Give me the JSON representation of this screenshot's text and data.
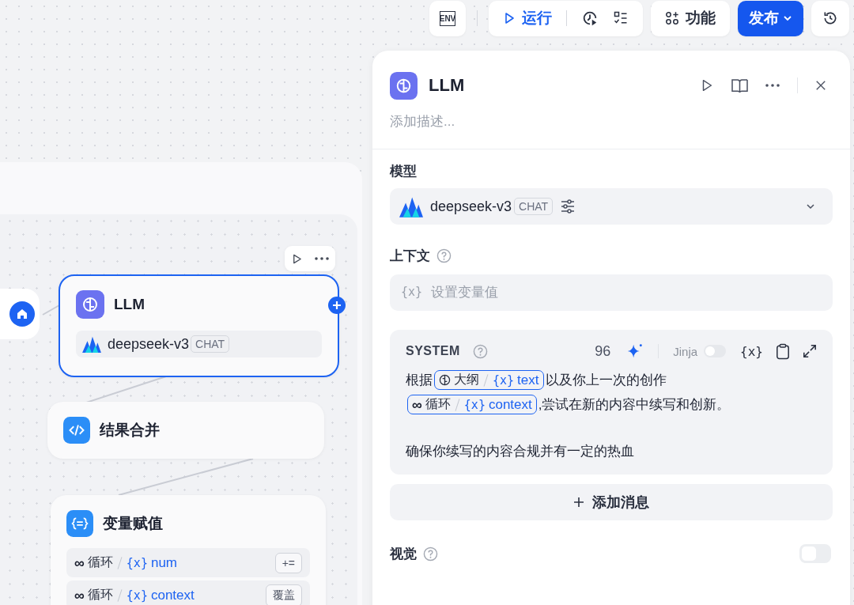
{
  "toolbar": {
    "env_label": "ENV",
    "run_label": "运行",
    "features_label": "功能",
    "publish_label": "发布"
  },
  "canvas": {
    "nodes": [
      {
        "kind": "start",
        "selected": false
      },
      {
        "kind": "llm",
        "selected": true,
        "title": "LLM",
        "model": "deepseek-v3",
        "tag": "CHAT"
      },
      {
        "kind": "code",
        "selected": false,
        "title": "结果合并"
      },
      {
        "kind": "assign",
        "selected": false,
        "title": "变量赋值",
        "rows": [
          {
            "source_icon": "∞",
            "source": "循环",
            "var_icon": "{x}",
            "name": "num",
            "op": "+="
          },
          {
            "source_icon": "∞",
            "source": "循环",
            "var_icon": "{x}",
            "name": "context",
            "op": "覆盖"
          }
        ]
      }
    ]
  },
  "panel": {
    "title": "LLM",
    "description_placeholder": "添加描述...",
    "model": {
      "label": "模型",
      "name": "deepseek-v3",
      "tag": "CHAT"
    },
    "context": {
      "label": "上下文",
      "var_icon": "{x}",
      "placeholder": "设置变量值"
    },
    "system": {
      "label": "SYSTEM",
      "count": "96",
      "jinja_label": "Jinja",
      "jinja_on": false,
      "var_icon": "{x}",
      "paragraphs": [
        {
          "lines": [
            {
              "segments": [
                {
                  "kind": "text",
                  "text": "根据"
                },
                {
                  "kind": "var",
                  "source": "大纲",
                  "var_icon": "{x}",
                  "name": "text"
                },
                {
                  "kind": "text",
                  "text": "以及你上一次的创作"
                }
              ]
            },
            {
              "segments": [
                {
                  "kind": "var",
                  "source_icon": "∞",
                  "source": "循环",
                  "var_icon": "{x}",
                  "name": "context"
                },
                {
                  "kind": "text",
                  "text": ",尝试在新的内容中续写和创新。"
                }
              ]
            }
          ]
        },
        {
          "lines": [
            {
              "segments": [
                {
                  "kind": "text",
                  "text": "确保你续写的内容合规并有一定的热血"
                }
              ]
            }
          ]
        }
      ]
    },
    "add_message_label": "添加消息",
    "vision": {
      "label": "视觉",
      "on": false
    }
  }
}
